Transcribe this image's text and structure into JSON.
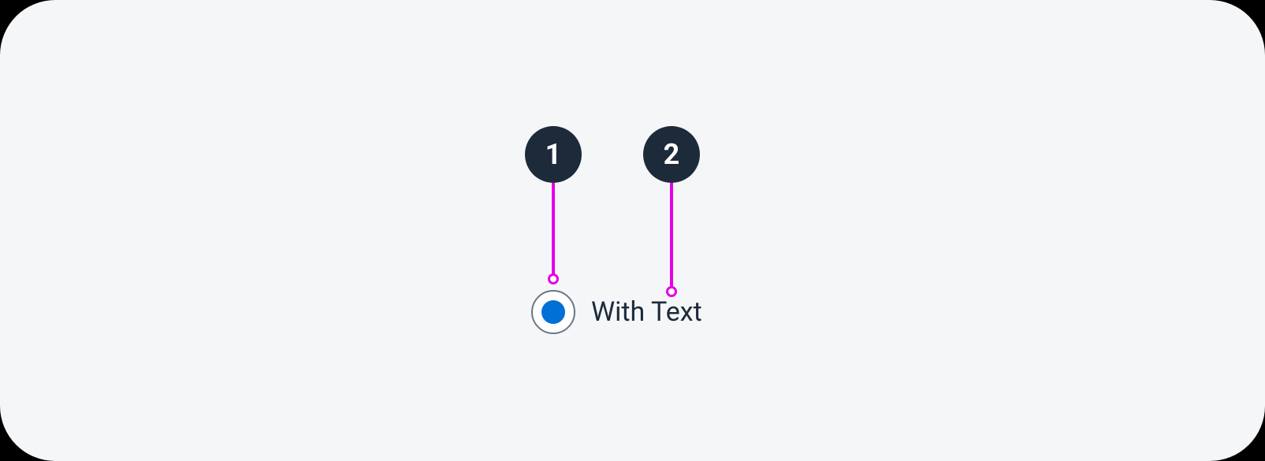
{
  "annotations": {
    "marker1": "1",
    "marker2": "2"
  },
  "radio": {
    "label": "With Text"
  }
}
